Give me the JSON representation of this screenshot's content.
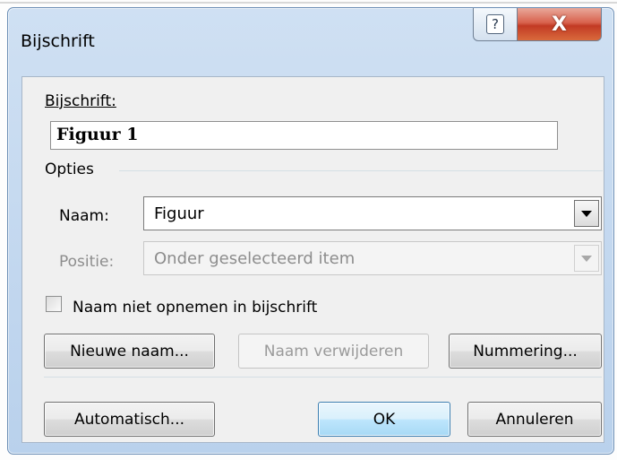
{
  "window": {
    "title": "Bijschrift",
    "help_glyph": "?",
    "close_glyph": "X"
  },
  "caption": {
    "label": "Bijschrift:",
    "value": "Figuur 1"
  },
  "options": {
    "section_label": "Opties",
    "name_label": "Naam:",
    "name_value": "Figuur",
    "position_label": "Positie:",
    "position_value": "Onder geselecteerd item"
  },
  "exclude_label": {
    "label": "Naam niet opnemen in bijschrift",
    "checked": false
  },
  "buttons": {
    "new_label": "Nieuwe naam...",
    "delete_label": "Naam verwijderen",
    "numbering_label": "Nummering...",
    "auto_label": "Automatisch...",
    "ok_label": "OK",
    "cancel_label": "Annuleren"
  },
  "colors": {
    "close_button": "#c23a24",
    "frame": "#b9d1ec",
    "default_button_border": "#3c7fb1"
  }
}
